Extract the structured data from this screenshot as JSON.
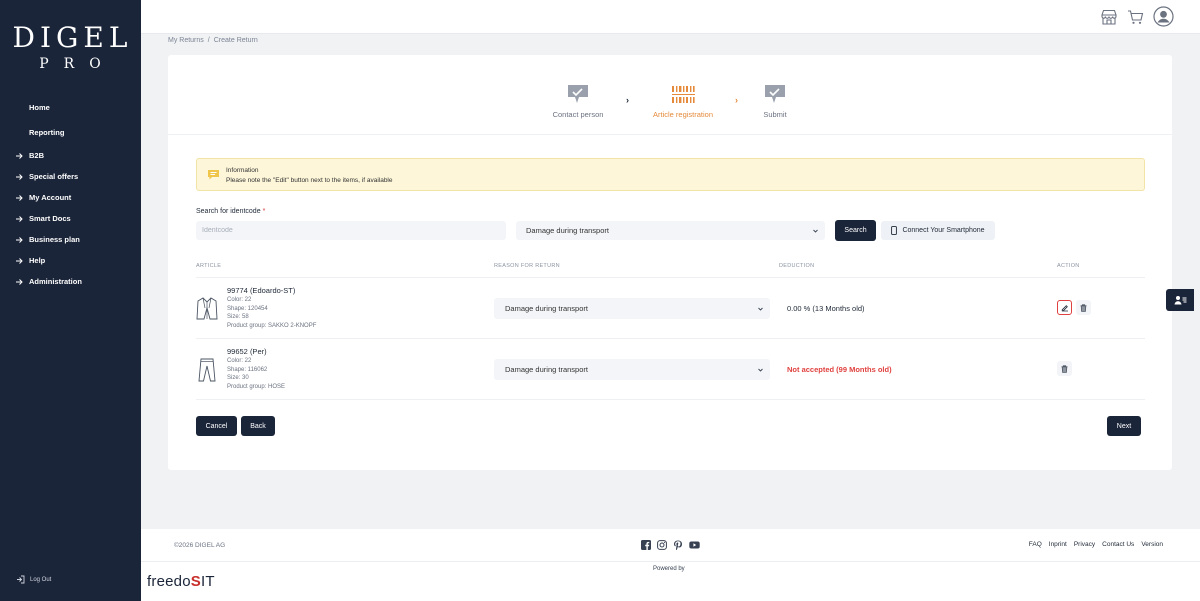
{
  "brand": {
    "name": "DIGEL",
    "sub": "PRO"
  },
  "sidebar": {
    "items": [
      {
        "label": "Home",
        "arrow": false
      },
      {
        "label": "Reporting",
        "arrow": false
      },
      {
        "label": "B2B",
        "arrow": true
      },
      {
        "label": "Special offers",
        "arrow": true
      },
      {
        "label": "My Account",
        "arrow": true
      },
      {
        "label": "Smart Docs",
        "arrow": true
      },
      {
        "label": "Business plan",
        "arrow": true
      },
      {
        "label": "Help",
        "arrow": true
      },
      {
        "label": "Administration",
        "arrow": true
      }
    ],
    "logout": "Log Out"
  },
  "header": {
    "icons": [
      "store-icon",
      "cart-icon",
      "user-avatar-icon"
    ]
  },
  "breadcrumb": {
    "parent": "My Returns",
    "sep": "/",
    "current": "Create Return"
  },
  "steps": [
    {
      "label": "Contact person",
      "state": "done"
    },
    {
      "label": "Article registration",
      "state": "active"
    },
    {
      "label": "Submit",
      "state": "pending"
    }
  ],
  "info": {
    "title": "Information",
    "text": "Please note the \"Edit\" button next to the items, if available"
  },
  "search": {
    "label": "Search for identcode",
    "required_mark": "*",
    "placeholder": "Identcode",
    "reason_selected": "Damage during transport",
    "search_button": "Search",
    "phone_button": "Connect Your Smartphone"
  },
  "table": {
    "headers": {
      "article": "ARTICLE",
      "reason": "REASON FOR RETURN",
      "deduction": "DEDUCTION",
      "action": "ACTION"
    },
    "rows": [
      {
        "title": "99774 (Edoardo-ST)",
        "color": "Color: 22",
        "shape": "Shape: 120454",
        "size": "Size: 58",
        "group": "Product group: SAKKO 2-KNOPF",
        "reason": "Damage during transport",
        "deduction": "0.00 % (13 Months old)",
        "deduction_ok": true,
        "editable": true,
        "icon": "jacket-icon"
      },
      {
        "title": "99652 (Per)",
        "color": "Color: 22",
        "shape": "Shape: 116062",
        "size": "Size: 30",
        "group": "Product group: HOSE",
        "reason": "Damage during transport",
        "deduction": "Not accepted (99 Months old)",
        "deduction_ok": false,
        "editable": false,
        "icon": "trousers-icon"
      }
    ]
  },
  "buttons": {
    "cancel": "Cancel",
    "back": "Back",
    "next": "Next"
  },
  "footer": {
    "copyright": "©2026 DIGEL AG",
    "links": [
      "FAQ",
      "Inprint",
      "Privacy",
      "Contact Us",
      "Version"
    ],
    "powered_by": "Powered by",
    "vendor_a": "freedo",
    "vendor_b": "IT"
  },
  "colors": {
    "sidebar": "#1b2539",
    "accent": "#e58a3a",
    "danger": "#e0423f",
    "info_bg": "#fdf6d9"
  }
}
